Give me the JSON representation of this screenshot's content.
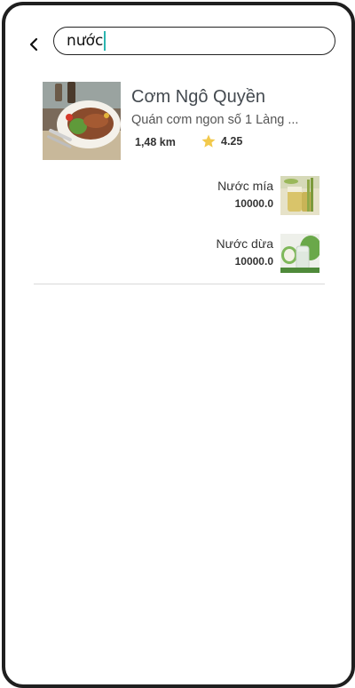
{
  "search": {
    "value": "nước"
  },
  "restaurant": {
    "name": "Cơm Ngô Quyền",
    "description": "Quán cơm ngon số 1 Làng ...",
    "distance": "1,48 km",
    "rating": "4.25"
  },
  "items": [
    {
      "name": "Nước mía",
      "price": "10000.0"
    },
    {
      "name": "Nước dừa",
      "price": "10000.0"
    }
  ],
  "colors": {
    "caret": "#2bb5b0",
    "star": "#f2c94c",
    "frame": "#1f1f1f"
  },
  "icons": [
    "back-arrow-icon",
    "star-icon"
  ]
}
